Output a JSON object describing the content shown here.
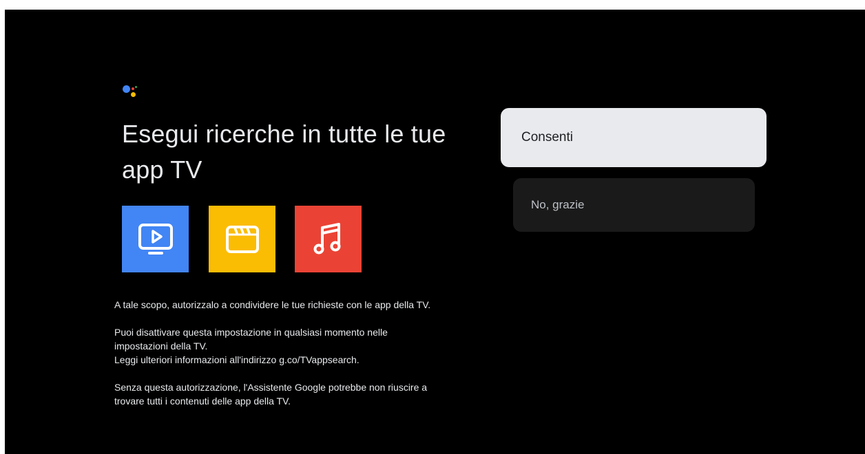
{
  "colors": {
    "screen_background": "#000000",
    "google_blue": "#4285F4",
    "google_red": "#EA4335",
    "google_yellow": "#FBBC04",
    "google_green": "#34A853",
    "focused_option": "#e8eaed",
    "unfocused_option": "#1a1a1a"
  },
  "header": {
    "logo_icon": "google-assistant-icon",
    "title": "Esegui ricerche in tutte le tue app TV"
  },
  "app_tiles": [
    {
      "icon": "tv-play-icon",
      "color": "#4285F4"
    },
    {
      "icon": "clapperboard-icon",
      "color": "#FBBC04"
    },
    {
      "icon": "music-note-icon",
      "color": "#EA4335"
    }
  ],
  "body": {
    "paragraph_1": "A tale scopo, autorizzalo a condividere le tue richieste con le app della TV.",
    "paragraph_2_line_1": "Puoi disattivare questa impostazione in qualsiasi momento nelle impostazioni della TV.",
    "paragraph_2_line_2": "Leggi ulteriori informazioni all'indirizzo g.co/TVappsearch.",
    "paragraph_3": "Senza questa autorizzazione, l'Assistente Google potrebbe non riuscire a trovare tutti i contenuti delle app della TV."
  },
  "options": {
    "allow_label": "Consenti",
    "decline_label": "No, grazie"
  }
}
